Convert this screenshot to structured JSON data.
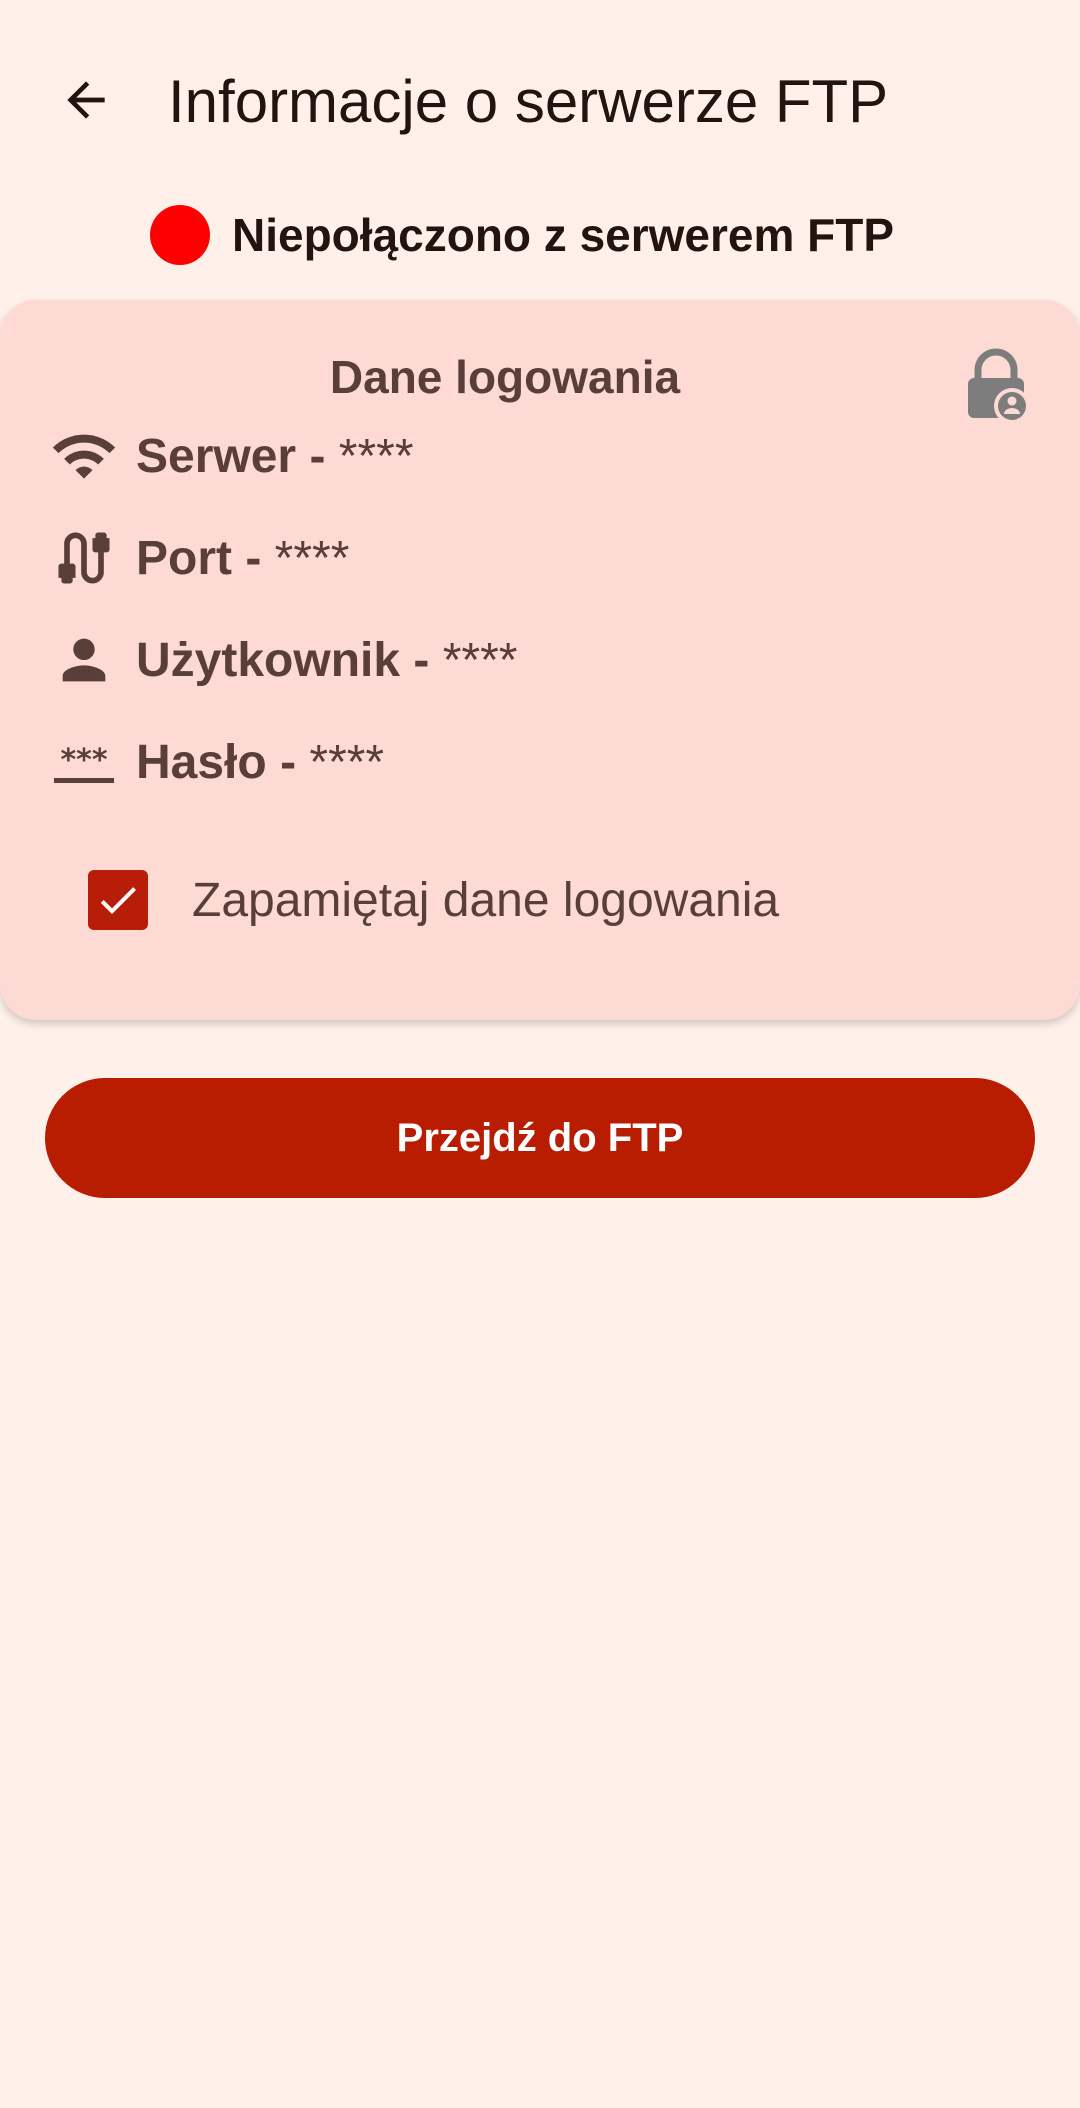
{
  "header": {
    "title": "Informacje o serwerze FTP",
    "back_icon": "arrow-back-icon"
  },
  "status": {
    "text": "Niepołączono z serwerem FTP",
    "dot_color": "#FF0000"
  },
  "credentials_card": {
    "title": "Dane logowania",
    "lock_icon": "lock-person-icon",
    "rows": [
      {
        "icon": "wifi-icon",
        "label": "Serwer",
        "separator": "-",
        "value": "****"
      },
      {
        "icon": "cable-icon",
        "label": "Port",
        "separator": "-",
        "value": "****"
      },
      {
        "icon": "person-icon",
        "label": "Użytkownik",
        "separator": "-",
        "value": "****"
      },
      {
        "icon": "password-icon",
        "label": "Hasło",
        "separator": "-",
        "value": "****"
      }
    ],
    "remember": {
      "label": "Zapamiętaj dane logowania",
      "checked": true
    }
  },
  "actions": {
    "go_to_ftp_label": "Przejdź do FTP"
  },
  "colors": {
    "background": "#FFF1E9",
    "card": "#FDDAD4",
    "primary": "#B81D02",
    "text_dark": "#24140F",
    "text_card": "#5A3E3A",
    "status_disconnected": "#FF0000"
  }
}
